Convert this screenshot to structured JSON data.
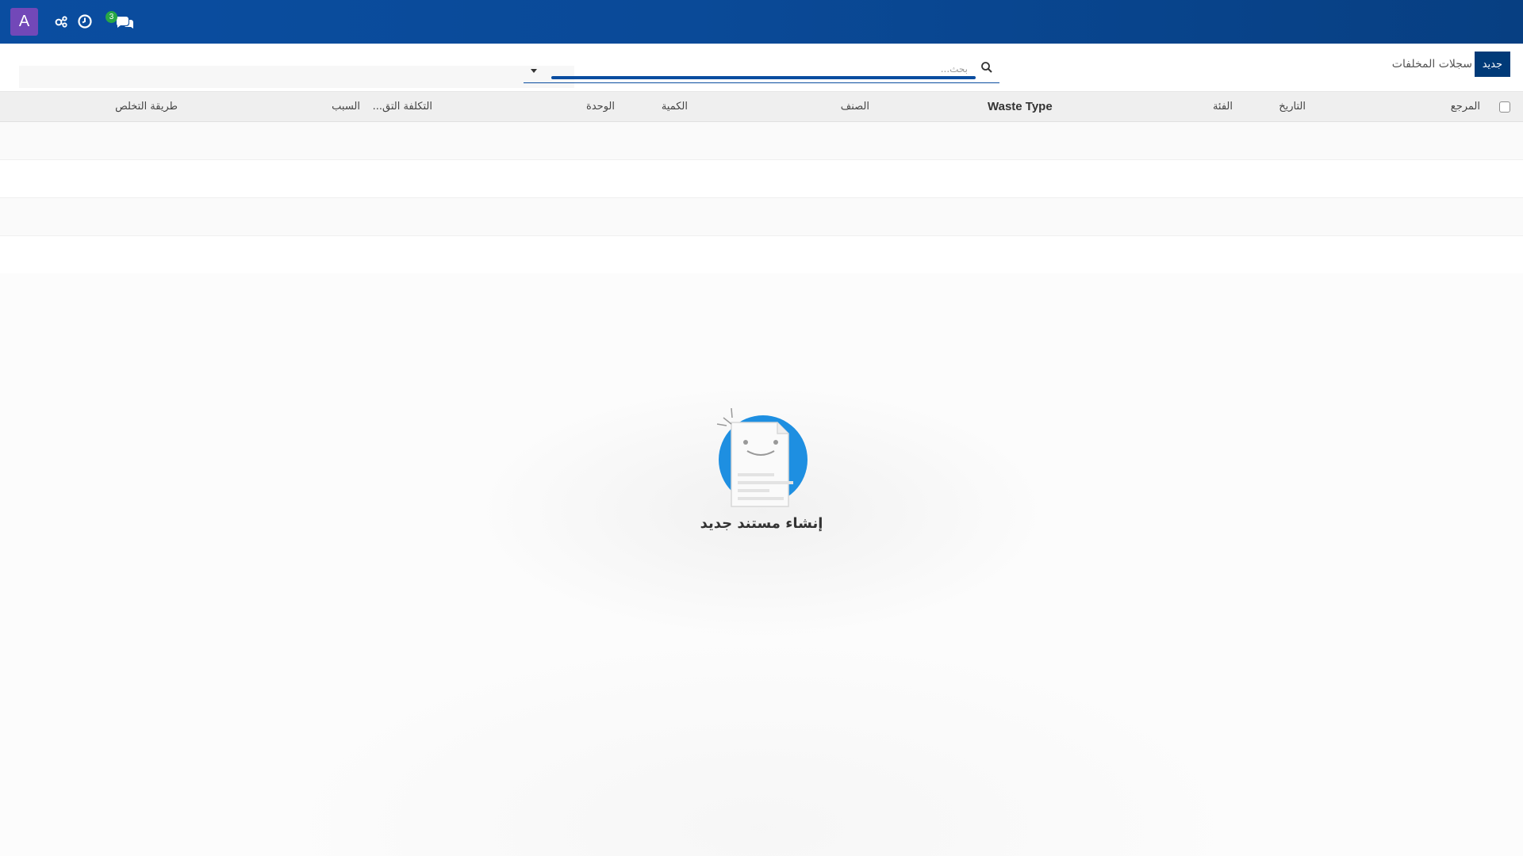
{
  "navbar": {
    "avatar_letter": "A",
    "icons": [
      "settings-share-icon",
      "clock-icon",
      "chat-icon"
    ],
    "chat_badge": "3",
    "colors": {
      "bar": "#0a4da0",
      "avatar": "#7248b8",
      "badge": "#28a745"
    }
  },
  "control_panel": {
    "new_button_label": "جديد",
    "title": "سجلات المخلفات",
    "search_placeholder": "بحث..."
  },
  "table": {
    "columns": [
      "المرجع",
      "التاريخ",
      "الفئة",
      "Waste Type",
      "الصنف",
      "الكمية",
      "الوحدة",
      "التكلفة التق...",
      "السبب",
      "طريقة التخلص"
    ],
    "rows": []
  },
  "empty_state": {
    "title": "إنشاء مستند جديد",
    "icon": "smiling-document-icon"
  }
}
